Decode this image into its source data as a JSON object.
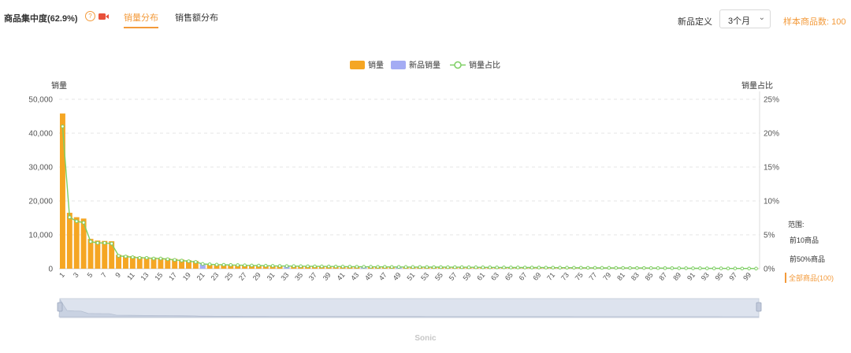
{
  "header": {
    "title": "商品集中度(62.9%)",
    "help_glyph": "?",
    "tabs": [
      {
        "label": "销量分布",
        "active": true
      },
      {
        "label": "销售额分布",
        "active": false
      }
    ],
    "new_def_label": "新品定义",
    "period_select": "3个月",
    "sample_count": "样本商品数: 100"
  },
  "colors": {
    "accent": "#f39a3a",
    "sales_bar": "#f5a623",
    "new_sales_bar": "#a4acf4",
    "ratio_line": "#7dcf63",
    "grid": "#e6e6e6"
  },
  "chart_data": {
    "type": "bar",
    "legend": [
      "销量",
      "新品销量",
      "销量占比"
    ],
    "legend_position": "top-center",
    "y_left_label": "销量",
    "y_right_label": "销量占比",
    "y_left_ticks": [
      "50,000",
      "40,000",
      "30,000",
      "20,000",
      "10,000",
      "0"
    ],
    "y_right_ticks": [
      "25%",
      "20%",
      "15%",
      "10%",
      "5%",
      "0%"
    ],
    "ylim_left": [
      0,
      50000
    ],
    "ylim_right": [
      0,
      25
    ],
    "grid": true,
    "categories": [
      1,
      2,
      3,
      4,
      5,
      6,
      7,
      8,
      9,
      10,
      11,
      12,
      13,
      14,
      15,
      16,
      17,
      18,
      19,
      20,
      21,
      22,
      23,
      24,
      25,
      26,
      27,
      28,
      29,
      30,
      31,
      32,
      33,
      34,
      35,
      36,
      37,
      38,
      39,
      40,
      41,
      42,
      43,
      44,
      45,
      46,
      47,
      48,
      49,
      50,
      51,
      52,
      53,
      54,
      55,
      56,
      57,
      58,
      59,
      60,
      61,
      62,
      63,
      64,
      65,
      66,
      67,
      68,
      69,
      70,
      71,
      72,
      73,
      74,
      75,
      76,
      77,
      78,
      79,
      80,
      81,
      82,
      83,
      84,
      85,
      86,
      87,
      88,
      89,
      90,
      91,
      92,
      93,
      94,
      95,
      96,
      97,
      98,
      99,
      100
    ],
    "x_tick_labels": [
      "1",
      "3",
      "5",
      "7",
      "9",
      "11",
      "13",
      "15",
      "17",
      "19",
      "21",
      "23",
      "25",
      "27",
      "29",
      "31",
      "33",
      "35",
      "37",
      "39",
      "41",
      "43",
      "45",
      "47",
      "49",
      "51",
      "53",
      "55",
      "57",
      "59",
      "61",
      "63",
      "65",
      "67",
      "69",
      "71",
      "73",
      "75",
      "77",
      "79",
      "81",
      "83",
      "85",
      "87",
      "89",
      "91",
      "93",
      "95",
      "97",
      "99"
    ],
    "series": [
      {
        "name": "销量",
        "values": [
          45800,
          16500,
          15200,
          14800,
          8800,
          8300,
          8200,
          8100,
          4100,
          3900,
          3700,
          3500,
          3400,
          3300,
          3200,
          3100,
          2900,
          2700,
          2500,
          2300,
          1500,
          1400,
          1300,
          1250,
          1200,
          1150,
          1100,
          1050,
          1000,
          950,
          900,
          880,
          850,
          820,
          800,
          780,
          760,
          740,
          720,
          700,
          680,
          660,
          640,
          620,
          600,
          590,
          580,
          570,
          560,
          550,
          540,
          530,
          520,
          510,
          500,
          490,
          480,
          470,
          460,
          450,
          440,
          430,
          420,
          410,
          400,
          390,
          380,
          370,
          360,
          350,
          340,
          330,
          320,
          310,
          300,
          290,
          280,
          270,
          260,
          250,
          240,
          230,
          220,
          210,
          200,
          190,
          180,
          170,
          160,
          150,
          140,
          130,
          120,
          110,
          100,
          90,
          80,
          70,
          60,
          50
        ]
      },
      {
        "name": "新品销量",
        "values": [
          0,
          0,
          0,
          0,
          0,
          0,
          0,
          0,
          0,
          0,
          0,
          0,
          0,
          0,
          0,
          0,
          0,
          0,
          0,
          0,
          1500,
          0,
          0,
          0,
          0,
          0,
          0,
          0,
          0,
          0,
          0,
          0,
          850,
          0,
          0,
          0,
          0,
          0,
          0,
          0,
          0,
          0,
          0,
          640,
          0,
          0,
          0,
          0,
          560,
          0,
          0,
          0,
          0,
          0,
          0,
          0,
          0,
          0,
          0,
          0,
          0,
          0,
          0,
          0,
          0,
          0,
          0,
          0,
          0,
          0,
          0,
          0,
          0,
          0,
          0,
          0,
          0,
          0,
          0,
          0,
          0,
          0,
          0,
          0,
          0,
          0,
          0,
          0,
          0,
          0,
          0,
          0,
          0,
          0,
          0,
          0,
          0,
          0,
          0,
          0
        ]
      },
      {
        "name": "销量占比",
        "unit": "%",
        "values": [
          21.0,
          7.6,
          7.0,
          6.8,
          4.0,
          3.8,
          3.8,
          3.7,
          1.9,
          1.8,
          1.7,
          1.6,
          1.6,
          1.5,
          1.5,
          1.4,
          1.3,
          1.2,
          1.1,
          1.0,
          0.7,
          0.65,
          0.6,
          0.58,
          0.55,
          0.53,
          0.5,
          0.48,
          0.46,
          0.44,
          0.42,
          0.4,
          0.39,
          0.38,
          0.37,
          0.36,
          0.35,
          0.34,
          0.33,
          0.32,
          0.31,
          0.3,
          0.29,
          0.28,
          0.28,
          0.27,
          0.27,
          0.26,
          0.26,
          0.25,
          0.25,
          0.24,
          0.24,
          0.23,
          0.23,
          0.22,
          0.22,
          0.22,
          0.21,
          0.21,
          0.2,
          0.2,
          0.19,
          0.19,
          0.18,
          0.18,
          0.17,
          0.17,
          0.17,
          0.16,
          0.16,
          0.15,
          0.15,
          0.14,
          0.14,
          0.13,
          0.13,
          0.12,
          0.12,
          0.11,
          0.11,
          0.1,
          0.1,
          0.1,
          0.09,
          0.09,
          0.08,
          0.08,
          0.07,
          0.07,
          0.06,
          0.06,
          0.05,
          0.05,
          0.05,
          0.04,
          0.04,
          0.03,
          0.03,
          0.02
        ]
      }
    ]
  },
  "side_panel": {
    "title": "范围:",
    "options": [
      {
        "label": "前10商品",
        "active": false
      },
      {
        "label": "前50%商品",
        "active": false
      },
      {
        "label": "全部商品(100)",
        "active": true
      }
    ]
  },
  "footer": "Sonic"
}
